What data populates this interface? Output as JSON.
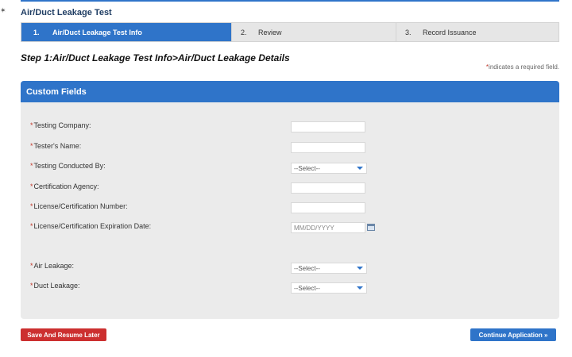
{
  "corner_mark": "✶",
  "page_title": "Air/Duct Leakage Test",
  "steps": [
    {
      "num": "1.",
      "label": "Air/Duct Leakage Test Info",
      "active": true
    },
    {
      "num": "2.",
      "label": "Review",
      "active": false
    },
    {
      "num": "3.",
      "label": "Record Issuance",
      "active": false
    }
  ],
  "step_heading": "Step 1:Air/Duct Leakage Test Info>Air/Duct Leakage Details",
  "required_note": {
    "star": "*",
    "text": "indicates a required field."
  },
  "panel": {
    "title": "Custom Fields",
    "fields": {
      "testing_company": {
        "label": "Testing Company:",
        "value": ""
      },
      "testers_name": {
        "label": "Tester's Name:",
        "value": ""
      },
      "testing_conducted_by": {
        "label": "Testing Conducted By:",
        "selected": "--Select--"
      },
      "certification_agency": {
        "label": "Certification Agency:",
        "value": ""
      },
      "license_number": {
        "label": "License/Certification Number:",
        "value": ""
      },
      "expiration_date": {
        "label": "License/Certification Expiration Date:",
        "placeholder": "MM/DD/YYYY"
      },
      "air_leakage": {
        "label": "Air Leakage:",
        "selected": "--Select--"
      },
      "duct_leakage": {
        "label": "Duct Leakage:",
        "selected": "--Select--"
      }
    },
    "required_star": "*"
  },
  "buttons": {
    "save": "Save And Resume Later",
    "continue": "Continue Application »"
  },
  "colors": {
    "accent": "#2f74c9",
    "danger": "#cc2f2f",
    "panel_bg": "#ebebeb",
    "required": "#c23a2c"
  }
}
